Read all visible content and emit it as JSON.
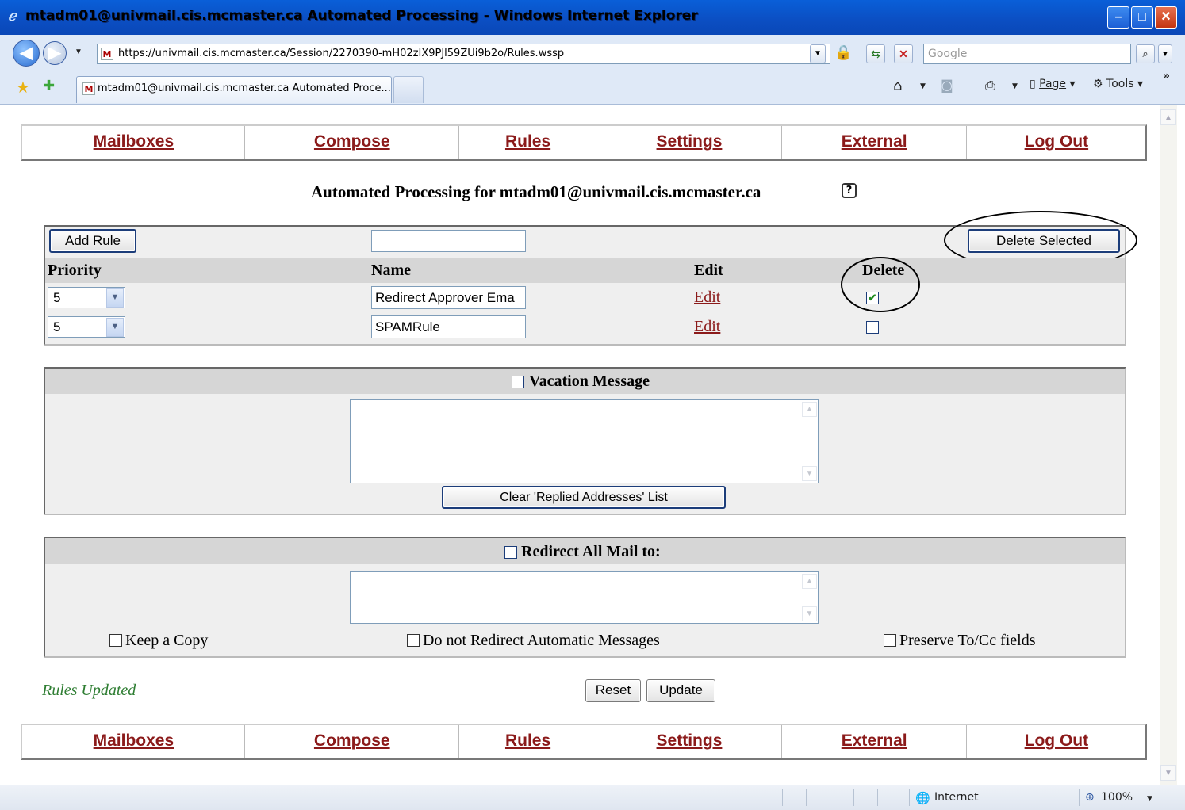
{
  "window": {
    "title": "mtadm01@univmail.cis.mcmaster.ca Automated Processing - Windows Internet Explorer",
    "url": "https://univmail.cis.mcmaster.ca/Session/2270390-mH02zIX9PJl59ZUi9b2o/Rules.wssp",
    "search_placeholder": "Google",
    "tab_title": "mtadm01@univmail.cis.mcmaster.ca Automated Proce...",
    "commands": {
      "page": "Page",
      "tools": "Tools"
    },
    "favicon_letter": "M"
  },
  "nav": [
    "Mailboxes",
    "Compose",
    "Rules",
    "Settings",
    "External",
    "Log Out"
  ],
  "page": {
    "title": "Automated Processing for mtadm01@univmail.cis.mcmaster.ca",
    "help": "?"
  },
  "rules": {
    "add_rule_label": "Add Rule",
    "new_rule_name": "",
    "delete_selected_label": "Delete Selected",
    "columns": {
      "priority": "Priority",
      "name": "Name",
      "edit": "Edit",
      "delete": "Delete"
    },
    "rows": [
      {
        "priority": "5",
        "name": "Redirect Approver Ema",
        "edit": "Edit",
        "delete_checked": true
      },
      {
        "priority": "5",
        "name": "SPAMRule",
        "edit": "Edit",
        "delete_checked": false
      }
    ]
  },
  "vacation": {
    "title": "Vacation Message",
    "enabled": false,
    "message": "",
    "clear_label": "Clear 'Replied Addresses' List"
  },
  "redirect": {
    "title": "Redirect All Mail to:",
    "enabled": false,
    "addresses": "",
    "options": [
      {
        "label": "Keep a Copy",
        "checked": false
      },
      {
        "label": "Do not Redirect Automatic Messages",
        "checked": false
      },
      {
        "label": "Preserve To/Cc fields",
        "checked": false
      }
    ]
  },
  "status_message": "Rules Updated",
  "form_buttons": {
    "reset": "Reset",
    "update": "Update"
  },
  "statusbar": {
    "zone": "Internet",
    "zoom": "100%"
  },
  "colors": {
    "link": "#8b1a1a",
    "status_ok": "#2e7d32",
    "titlebar": "#0b4ec2"
  }
}
